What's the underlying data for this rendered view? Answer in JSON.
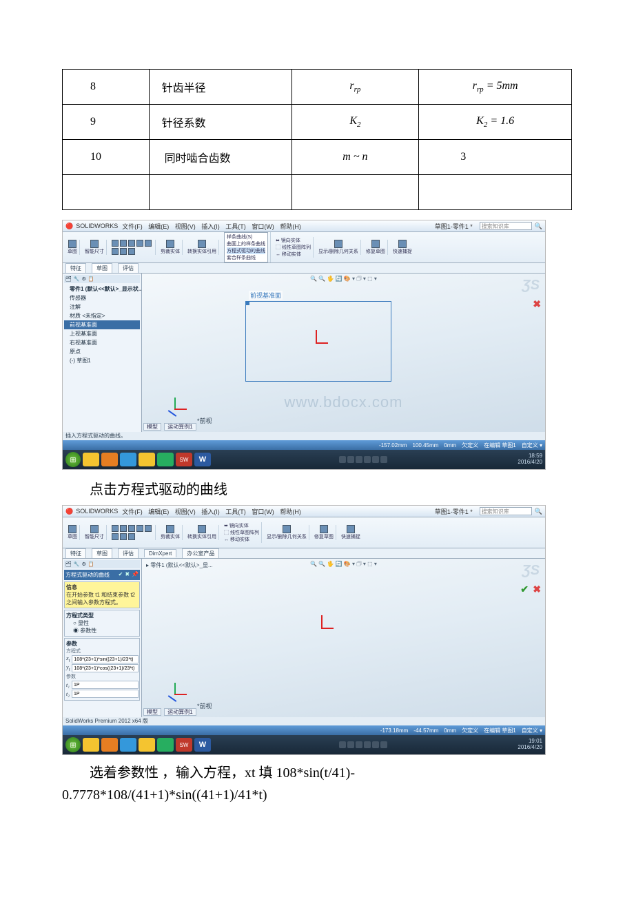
{
  "table": {
    "rows": [
      {
        "n": "8",
        "name": "针齿半径",
        "sym": "r<sub class='sub'>rp</sub>",
        "val": "r<sub class='sub'>rp</sub> = 5mm"
      },
      {
        "n": "9",
        "name": "针径系数",
        "sym": "K<sub class='sub'>2</sub>",
        "val": "K<sub class='sub'>2</sub> = 1.6"
      },
      {
        "n": "10",
        "name": "　同时啮合齿数",
        "sym": "m ~ n",
        "val": "3"
      },
      {
        "n": "",
        "name": "",
        "sym": "",
        "val": ""
      }
    ]
  },
  "caption1": "点击方程式驱动的曲线",
  "caption2a": "选着参数性 ，输入方程，xt 填 108*sin(t/41)-",
  "caption2b": "0.7778*108/(41+1)*sin((41+1)/41*t)",
  "sw": {
    "app": "SOLIDWORKS",
    "menus": [
      "文件(F)",
      "编辑(E)",
      "视图(V)",
      "插入(I)",
      "工具(T)",
      "窗口(W)",
      "帮助(H)"
    ],
    "doc_tab": "草图1-零件1 *",
    "search_placeholder": "搜索知识库",
    "tabs": [
      "特征",
      "草图",
      "评估"
    ],
    "tabs2": [
      "特征",
      "草图",
      "评估",
      "DimXpert",
      "办公室产品"
    ],
    "tree_root": "零件1 (默认<<默认>_显示状...",
    "tree": [
      "传感器",
      "注解",
      "材质 <未指定>",
      "前视基准面",
      "上视基准面",
      "右视基准面",
      "原点",
      "(-) 草图1"
    ],
    "tree_sel_index": 3,
    "plane_label": "前视基准面",
    "view_label": "*前视",
    "bottom_tabs": [
      "模型",
      "运动算例1"
    ],
    "status_hint": "插入方程式驱动的曲线。",
    "status1": {
      "x": "-157.02mm",
      "y": "100.45mm",
      "z": "0mm",
      "mode": "欠定义",
      "edit": "在编辑 草图1",
      "custom": "自定义 ▾"
    },
    "taskbar_time1": "18:59",
    "taskbar_date1": "2016/4/20",
    "premium": "SolidWorks Premium 2012 x64 版",
    "crumb": "零件1 (默认<<默认>_显...",
    "propmgr": {
      "title": "方程式驱动的曲线",
      "msg_title": "信息",
      "msg": "在开始参数 t1 和结束参数 t2 之间输入参数方程式。",
      "type_title": "方程式类型",
      "opt1": "显性",
      "opt2": "参数性",
      "param_title": "参数",
      "eq_label": "方程式",
      "xt": "x<sub>t</sub>",
      "yt": "y<sub>t</sub>",
      "xt_val": "108*(23+1)*sin((23+1)/23*t)",
      "yt_val": "108*(23+1)*cos((23+1)/23*t)",
      "range_label": "参数",
      "t1": "t₁",
      "t1_val": "1P",
      "t2": "t₂",
      "t2_val": "1P"
    },
    "status2": {
      "x": "-173.18mm",
      "y": "-44.57mm",
      "z": "0mm",
      "mode": "欠定义",
      "edit": "在编辑 草图1",
      "custom": "自定义 ▾"
    },
    "taskbar_time2": "19:01",
    "taskbar_date2": "2016/4/20"
  },
  "watermark": "www.bdocx.com"
}
